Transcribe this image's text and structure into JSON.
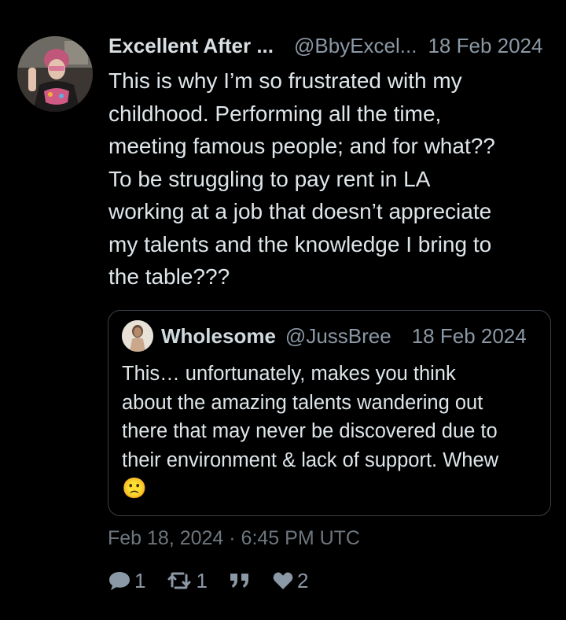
{
  "tweet": {
    "display_name": "Excellent After ...",
    "handle": "@BbyExcel...",
    "date": "18 Feb 2024",
    "text": "This is why I’m so frustrated with my\nchildhood. Performing all the time,\nmeeting famous people; and for what??\nTo be struggling to pay rent in LA\nworking at a job that doesn’t appreciate\nmy talents and the knowledge I bring to\nthe table???",
    "timestamp": "Feb 18, 2024 · 6:45 PM UTC"
  },
  "quote": {
    "display_name": "Wholesome",
    "handle": "@JussBree",
    "date": "18 Feb 2024",
    "text": "This… unfortunately, makes you think\nabout the amazing talents wandering out\nthere that may never be discovered due to\ntheir environment & lack of support. Whew\n🙁"
  },
  "stats": {
    "replies": "1",
    "retweets": "1",
    "likes": "2"
  },
  "icons": {
    "reply": "speech-bubble-icon",
    "retweet": "retweet-icon",
    "quote": "quote-icon",
    "like": "heart-icon"
  },
  "colors": {
    "background": "#000000",
    "text": "#dfe6ea",
    "muted": "#8b98a5",
    "border": "#3a4147"
  }
}
